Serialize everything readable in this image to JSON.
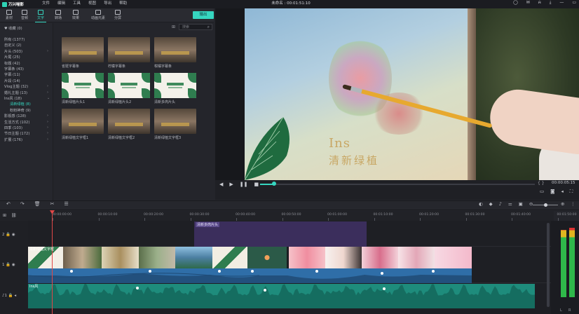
{
  "app": {
    "name": "万兴喵影",
    "title": "未命名 : 00:01:51:10"
  },
  "menu": [
    "文件",
    "编辑",
    "工具",
    "视图",
    "导出",
    "帮助"
  ],
  "window_controls": [
    "user-icon",
    "mail-icon",
    "bell-icon",
    "download-icon",
    "minimize-icon",
    "maximize-icon",
    "close-icon"
  ],
  "tabs": [
    {
      "label": "素材",
      "icon": "folder-icon"
    },
    {
      "label": "音频",
      "icon": "music-icon"
    },
    {
      "label": "文字",
      "icon": "text-icon",
      "active": true
    },
    {
      "label": "转场",
      "icon": "transition-icon"
    },
    {
      "label": "效果",
      "icon": "effects-icon"
    },
    {
      "label": "动画元素",
      "icon": "sticker-icon"
    },
    {
      "label": "分屏",
      "icon": "split-screen-icon"
    }
  ],
  "export_label": "输出",
  "categories": [
    {
      "label": "♥ 收藏 (0)"
    },
    {
      "label": "所有 (1377)"
    },
    {
      "label": "自定义 (2)"
    },
    {
      "label": "片头 (503)",
      "chev": true
    },
    {
      "label": "片尾 (25)"
    },
    {
      "label": "标题 (42)"
    },
    {
      "label": "字幕条 (43)"
    },
    {
      "label": "字幕 (11)"
    },
    {
      "label": "片段 (14)"
    },
    {
      "label": "Vlog主题 (32)",
      "chev": true
    },
    {
      "label": "婚礼主题 (13)",
      "chev": true
    },
    {
      "label": "Ins风 (18)",
      "chev": true,
      "open": true
    },
    {
      "label": "清新绿植 (8)",
      "sub": true,
      "selected": true
    },
    {
      "label": "粉粉神奇 (9)",
      "sub": true
    },
    {
      "label": "影视感 (128)",
      "chev": true
    },
    {
      "label": "生活方式 (102)",
      "chev": true
    },
    {
      "label": "四季 (103)",
      "chev": true
    },
    {
      "label": "节日主题 (172)",
      "chev": true
    },
    {
      "label": "扩展 (176)",
      "chev": true
    }
  ],
  "search": {
    "placeholder": "搜索"
  },
  "library": [
    {
      "label": "雀斑字幕条",
      "style": "dark"
    },
    {
      "label": "柠檬字幕条",
      "style": "dark"
    },
    {
      "label": "柑橘字幕条",
      "style": "dark"
    },
    {
      "label": "清新绿植片头1",
      "style": "light"
    },
    {
      "label": "清新绿植片头2",
      "style": "light"
    },
    {
      "label": "清新多肉片头",
      "style": "light"
    },
    {
      "label": "清新绿植文字框1",
      "style": "dark"
    },
    {
      "label": "清新绿植文字框2",
      "style": "dark"
    },
    {
      "label": "清新绿植文字框3",
      "style": "dark"
    }
  ],
  "preview": {
    "line1": "Ins",
    "line2": "清新绿植",
    "timecode": "00:00:05:15"
  },
  "playback": {
    "progress": 0.05,
    "brackets": "{   }"
  },
  "ruler": [
    "00:00:00:00",
    "00:00:10:00",
    "00:00:20:00",
    "00:00:30:00",
    "00:00:40:00",
    "00:00:50:00",
    "00:01:00:00",
    "00:01:10:00",
    "00:01:20:00",
    "00:01:30:00",
    "00:01:40:00",
    "00:01:50:00"
  ],
  "tracks": {
    "title_clip": "清新多肉片头",
    "video_clip": "清新绿植文字框",
    "audio_clip": "Ins风",
    "headers": [
      "2",
      "1",
      "1"
    ]
  },
  "meters": {
    "left": "L",
    "right": "R"
  }
}
